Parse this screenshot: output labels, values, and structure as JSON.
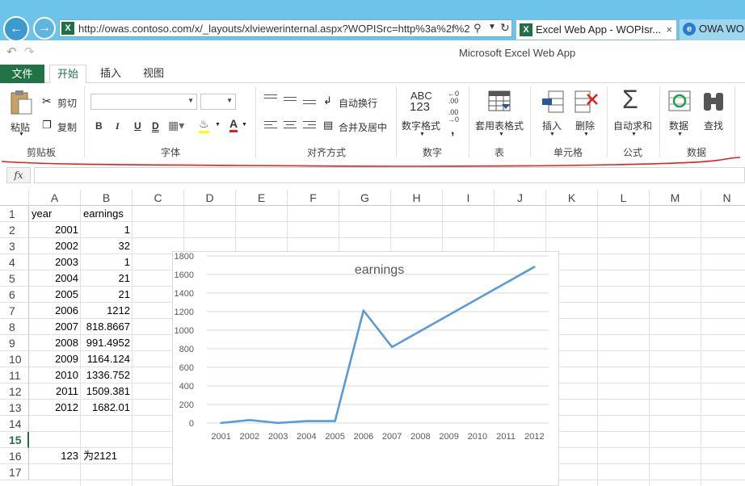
{
  "browser": {
    "address": "http://owas.contoso.com/x/_layouts/xlviewerinternal.aspx?WOPISrc=http%3a%2f%2",
    "tabs": [
      {
        "label": "Excel Web App - WOPIsr..."
      },
      {
        "label": "OWA WOP"
      }
    ],
    "close_glyph": "×"
  },
  "app_title": "Microsoft Excel Web App",
  "ribbon_tabs": {
    "file": "文件",
    "home": "开始",
    "insert": "插入",
    "view": "视图"
  },
  "ribbon": {
    "clipboard": {
      "paste": "粘贴",
      "cut": "剪切",
      "copy": "复制",
      "group": "剪贴板"
    },
    "font": {
      "bold": "B",
      "italic": "I",
      "underline": "U",
      "double_underline": "D",
      "group": "字体"
    },
    "alignment": {
      "wrap": "自动换行",
      "merge": "合并及居中",
      "group": "对齐方式"
    },
    "number": {
      "abc": "ABC",
      "num": "123",
      "format": "数字格式",
      "group": "数字"
    },
    "table": {
      "format_as_table": "套用表格式",
      "group": "表"
    },
    "cells": {
      "insert": "插入",
      "delete": "删除",
      "group": "单元格"
    },
    "formula": {
      "autosum": "自动求和",
      "group": "公式"
    },
    "data": {
      "data": "数据",
      "find": "查找",
      "group": "数据"
    }
  },
  "formula_bar": {
    "fx": "fx",
    "value": ""
  },
  "sheet": {
    "columns": [
      "A",
      "B",
      "C",
      "D",
      "E",
      "F",
      "G",
      "H",
      "I",
      "J",
      "K",
      "L",
      "M",
      "N"
    ],
    "rows": [
      "1",
      "2",
      "3",
      "4",
      "5",
      "6",
      "7",
      "8",
      "9",
      "10",
      "11",
      "12",
      "13",
      "14",
      "15",
      "16",
      "17"
    ],
    "active_row": "15",
    "cells": {
      "A1": "year",
      "B1": "earnings",
      "A2": "2001",
      "B2": "1",
      "A3": "2002",
      "B3": "32",
      "A4": "2003",
      "B4": "1",
      "A5": "2004",
      "B5": "21",
      "A6": "2005",
      "B6": "21",
      "A7": "2006",
      "B7": "1212",
      "A8": "2007",
      "B8": "818.8667",
      "A9": "2008",
      "B9": "991.4952",
      "A10": "2009",
      "B10": "1164.124",
      "A11": "2010",
      "B11": "1336.752",
      "A12": "2011",
      "B12": "1509.381",
      "A13": "2012",
      "B13": "1682.01",
      "A16": "123",
      "B16": "为2121"
    }
  },
  "chart_data": {
    "type": "line",
    "title": "earnings",
    "categories": [
      "2001",
      "2002",
      "2003",
      "2004",
      "2005",
      "2006",
      "2007",
      "2008",
      "2009",
      "2010",
      "2011",
      "2012"
    ],
    "series": [
      {
        "values": [
          1,
          32,
          1,
          21,
          21,
          1212,
          818.8667,
          991.4952,
          1164.124,
          1336.752,
          1509.381,
          1682.01
        ]
      }
    ],
    "yticks": [
      "0",
      "200",
      "400",
      "600",
      "800",
      "1000",
      "1200",
      "1400",
      "1600",
      "1800"
    ],
    "ylim": [
      0,
      1800
    ],
    "xlabel": "",
    "ylabel": "",
    "grid": true,
    "line_color": "#5b9bd5"
  },
  "colors": {
    "excel_green": "#217346",
    "annotation_red": "#e0201c",
    "browser_blue": "#6cc4ea"
  }
}
